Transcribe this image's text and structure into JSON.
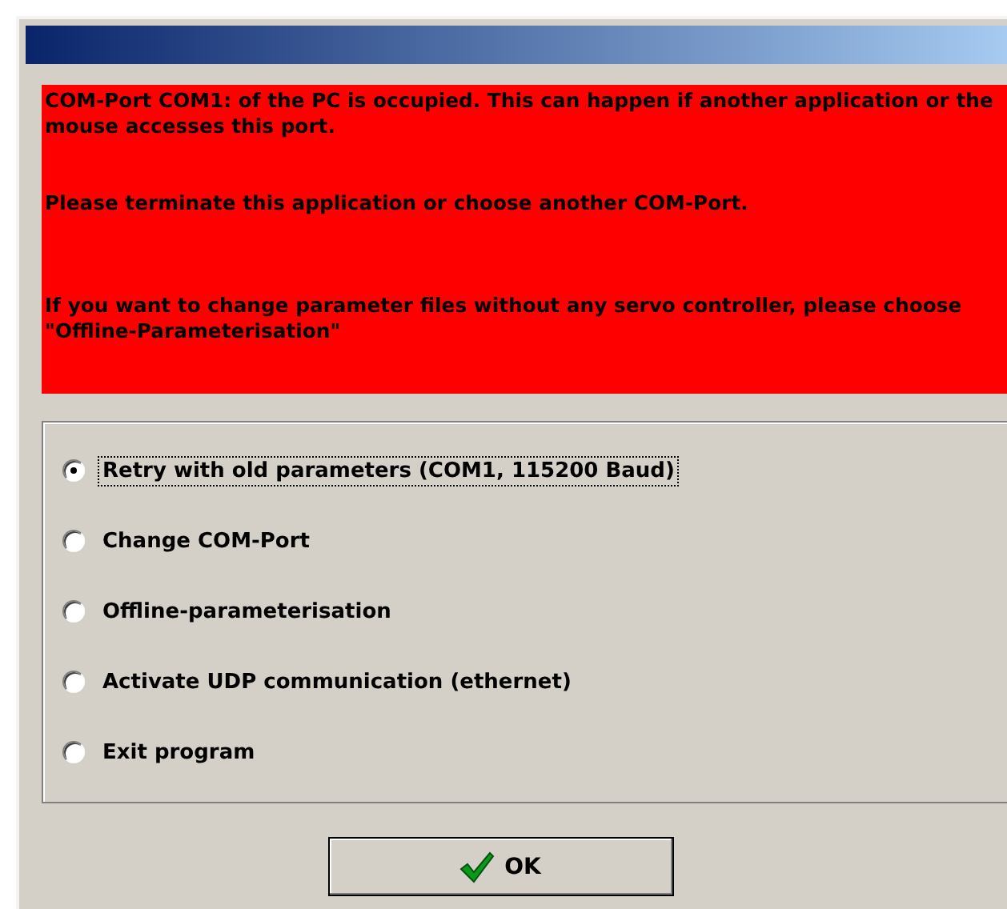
{
  "message": {
    "paragraphs": [
      "COM-Port COM1: of the PC is occupied. This can happen if another application or the mouse accesses this port.",
      "Please terminate this application or choose another COM-Port.",
      "If you want to change parameter files without any servo controller, please choose \"Offline-Parameterisation\""
    ]
  },
  "options": [
    {
      "label": "Retry with old parameters (COM1, 115200 Baud)",
      "selected": true
    },
    {
      "label": "Change COM-Port",
      "selected": false
    },
    {
      "label": "Offline-parameterisation",
      "selected": false
    },
    {
      "label": "Activate UDP communication (ethernet)",
      "selected": false
    },
    {
      "label": "Exit program",
      "selected": false
    }
  ],
  "ok_button": {
    "label": "OK"
  }
}
